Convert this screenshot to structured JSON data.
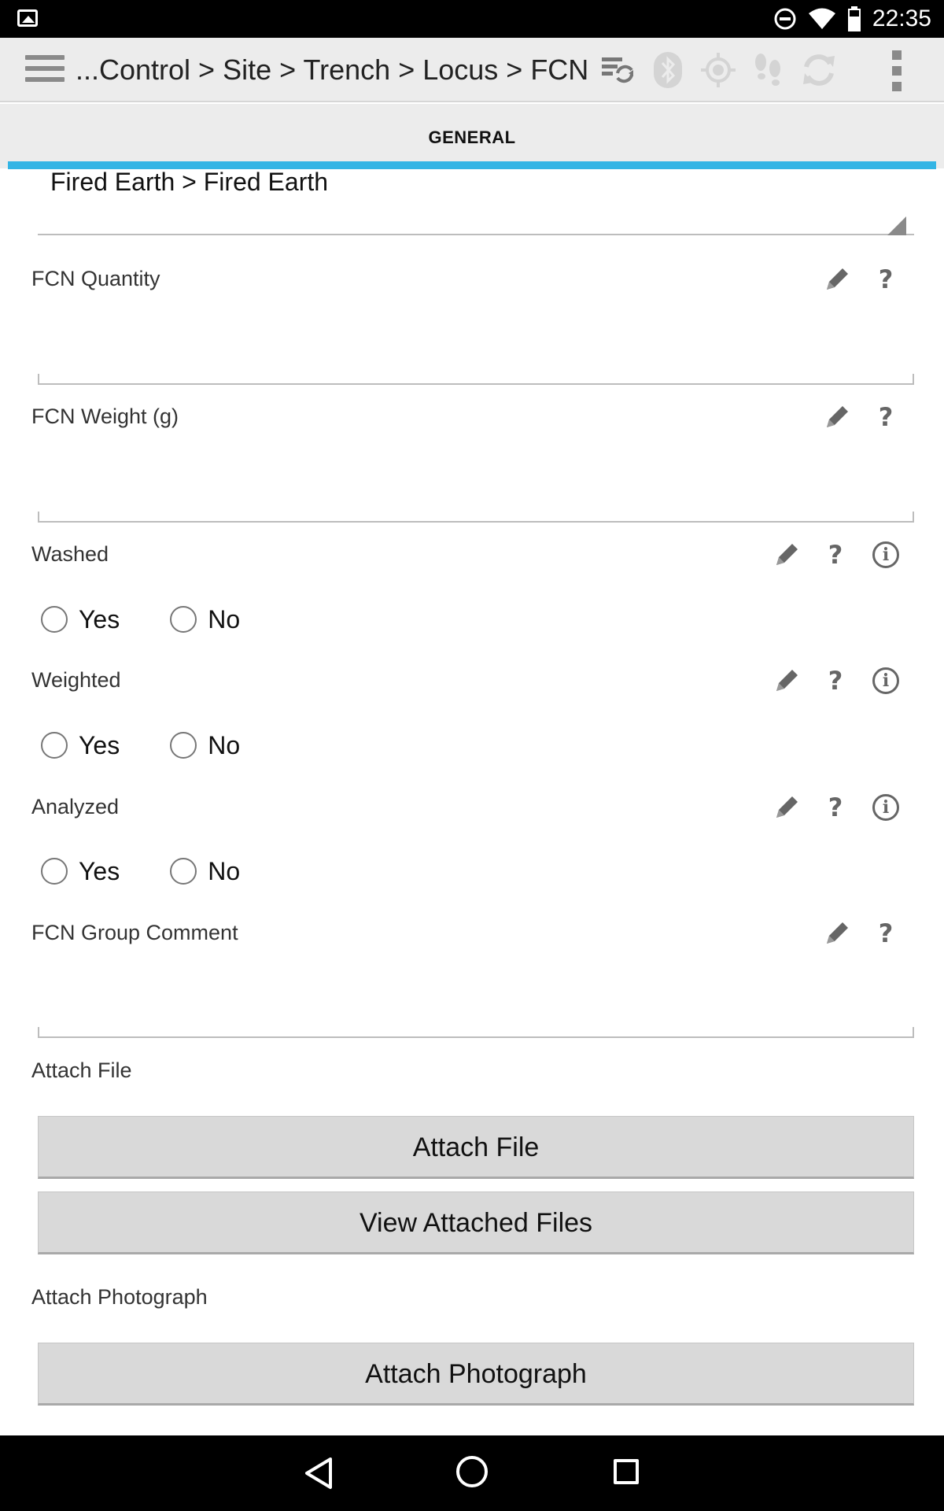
{
  "status_bar": {
    "time": "22:35",
    "icons": [
      "gallery-icon",
      "dnd-icon",
      "wifi-icon",
      "battery-icon"
    ]
  },
  "action_bar": {
    "breadcrumb": "...Control > Site > Trench > Locus > FCN",
    "icons": [
      "menu-icon",
      "sync-list-icon",
      "bluetooth-icon",
      "gps-icon",
      "tracking-icon",
      "refresh-icon",
      "overflow-icon"
    ]
  },
  "tabs": [
    {
      "label": "GENERAL",
      "active": true
    }
  ],
  "form": {
    "spinner_value": "Fired Earth > Fired Earth",
    "fcn_quantity": {
      "label": "FCN Quantity",
      "value": ""
    },
    "fcn_weight": {
      "label": "FCN Weight (g)",
      "value": ""
    },
    "washed": {
      "label": "Washed",
      "options": [
        "Yes",
        "No"
      ]
    },
    "weighted": {
      "label": "Weighted",
      "options": [
        "Yes",
        "No"
      ]
    },
    "analyzed": {
      "label": "Analyzed",
      "options": [
        "Yes",
        "No"
      ]
    },
    "fcn_group_comment": {
      "label": "FCN Group Comment",
      "value": ""
    },
    "attach_file": {
      "label": "Attach File",
      "button": "Attach File",
      "view_button": "View Attached Files"
    },
    "attach_photograph": {
      "label": "Attach Photograph",
      "button": "Attach Photograph"
    },
    "help_glyph": "?",
    "info_glyph": "i"
  },
  "colors": {
    "accent": "#33b5e5",
    "action_bar": "#ececec",
    "button": "#d9d9d9"
  }
}
